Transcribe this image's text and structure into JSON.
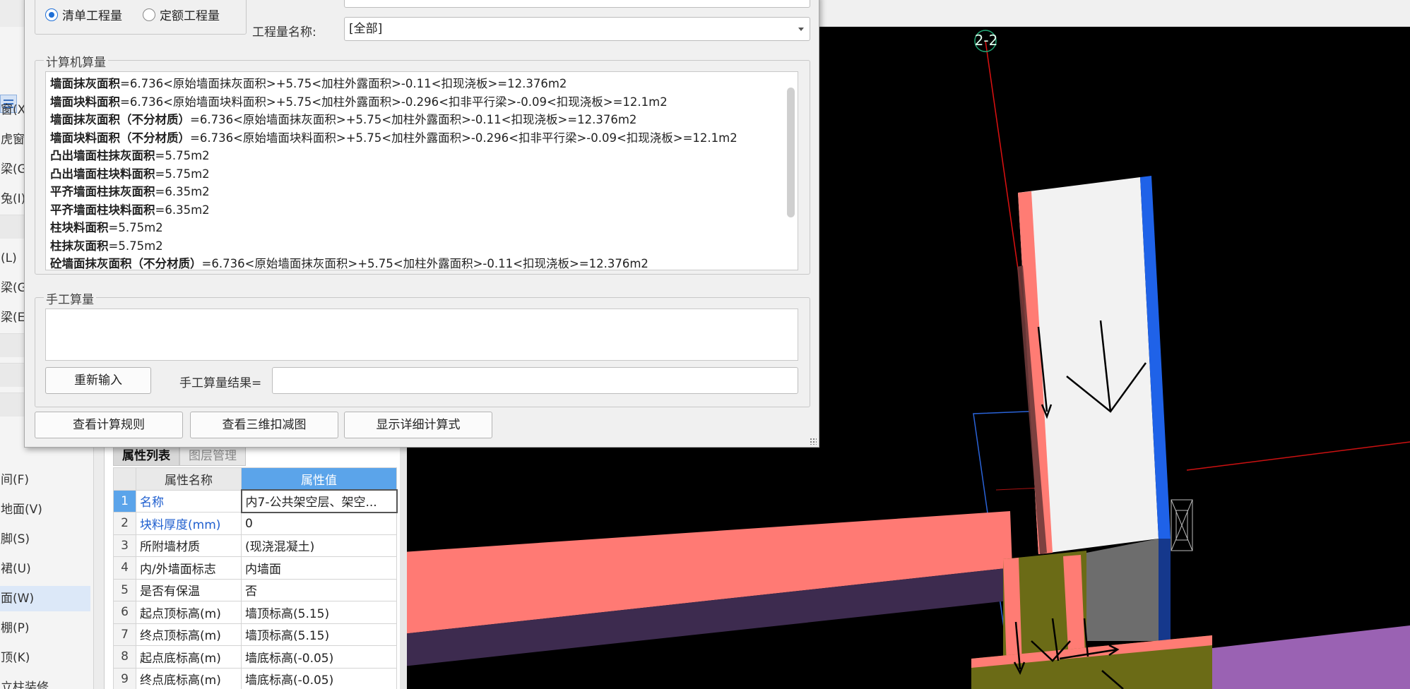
{
  "sidebar": {
    "items": [
      "窗(X",
      "虎窗",
      "梁(G",
      "兔(I)",
      "(L)",
      "梁(G",
      "梁(E",
      "间(F)",
      "地面(V)",
      "脚(S)",
      "裙(U)",
      "面(W)",
      "棚(P)",
      "顶(K)",
      "立柱装修"
    ]
  },
  "dialog": {
    "radio_qd": "清单工程量",
    "radio_de": "定额工程量",
    "name_label": "工程量名称:",
    "name_value": "[全部]",
    "calc_title": "计算机算量",
    "calc_lines": [
      {
        "b": "墙面抹灰面积",
        "t": "=6.736<原始墙面抹灰面积>+5.75<加柱外露面积>-0.11<扣现浇板>=12.376m2"
      },
      {
        "b": "墙面块料面积",
        "t": "=6.736<原始墙面块料面积>+5.75<加柱外露面积>-0.296<扣非平行梁>-0.09<扣现浇板>=12.1m2"
      },
      {
        "b": "墙面抹灰面积（不分材质）",
        "t": "=6.736<原始墙面抹灰面积>+5.75<加柱外露面积>-0.11<扣现浇板>=12.376m2"
      },
      {
        "b": "墙面块料面积（不分材质）",
        "t": "=6.736<原始墙面块料面积>+5.75<加柱外露面积>-0.296<扣非平行梁>-0.09<扣现浇板>=12.1m2"
      },
      {
        "b": "凸出墙面柱抹灰面积",
        "t": "=5.75m2"
      },
      {
        "b": "凸出墙面柱块料面积",
        "t": "=5.75m2"
      },
      {
        "b": "平齐墙面柱抹灰面积",
        "t": "=6.35m2"
      },
      {
        "b": "平齐墙面柱块料面积",
        "t": "=6.35m2"
      },
      {
        "b": "柱块料面积",
        "t": "=5.75m2"
      },
      {
        "b": "柱抹灰面积",
        "t": "=5.75m2"
      },
      {
        "b": "砼墙面抹灰面积（不分材质）",
        "t": "=6.736<原始墙面抹灰面积>+5.75<加柱外露面积>-0.11<扣现浇板>=12.376m2"
      }
    ],
    "manual_title": "手工算量",
    "reenter_button": "重新输入",
    "manual_result_label": "手工算量结果=",
    "btn_rules": "查看计算规则",
    "btn_3d": "查看三维扣减图",
    "btn_detail": "显示详细计算式"
  },
  "props": {
    "tab_list": "属性列表",
    "tab_layer": "图层管理",
    "head_name": "属性名称",
    "head_value": "属性值",
    "rows": [
      {
        "i": "1",
        "n": "名称",
        "v": "内7-公共架空层、架空..."
      },
      {
        "i": "2",
        "n": "块料厚度(mm)",
        "v": "0"
      },
      {
        "i": "3",
        "n": "所附墙材质",
        "v": "(现浇混凝土)"
      },
      {
        "i": "4",
        "n": "内/外墙面标志",
        "v": "内墙面"
      },
      {
        "i": "5",
        "n": "是否有保温",
        "v": "否"
      },
      {
        "i": "6",
        "n": "起点顶标高(m)",
        "v": "墙顶标高(5.15)"
      },
      {
        "i": "7",
        "n": "终点顶标高(m)",
        "v": "墙顶标高(5.15)"
      },
      {
        "i": "8",
        "n": "起点底标高(m)",
        "v": "墙底标高(-0.05)"
      },
      {
        "i": "9",
        "n": "终点底标高(m)",
        "v": "墙底标高(-0.05)"
      }
    ]
  },
  "viewport": {
    "axis_label": "2-2"
  }
}
